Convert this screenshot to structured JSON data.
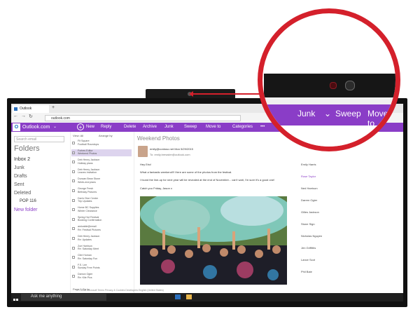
{
  "browser": {
    "tab_title": "Outlook",
    "address": "outlook.com"
  },
  "outlook_bar": {
    "logo": "O",
    "brand": "Outlook.com",
    "new": "New",
    "reply": "Reply",
    "delete": "Delete",
    "archive": "Archive",
    "junk": "Junk",
    "sweep": "Sweep",
    "move_to": "Move to",
    "categories": "Categories",
    "more": "•••"
  },
  "folders": {
    "search_placeholder": "Search email",
    "title": "Folders",
    "items": [
      {
        "label": "Inbox  2"
      },
      {
        "label": "Junk"
      },
      {
        "label": "Drafts"
      },
      {
        "label": "Sent"
      },
      {
        "label": "Deleted"
      },
      {
        "label": "POP  116"
      },
      {
        "label": "New folder"
      }
    ]
  },
  "list": {
    "header": "View: All",
    "arrange": "Arrange by",
    "messages": [
      "Fit Square\nFootball Roundups",
      "Forbes Editor\nWeekend Photos",
      "Deb Henry Jackson\nHoliday plans",
      "Deb Henry Jackson\nLeaves Invitation",
      "Duncan Bean Stone\nWeek-end plans",
      "George Fresh\nBirthday Pictures",
      "Dan's Dive Center\nTrip Updates",
      "Home BC Supplies\nWinter Clearance",
      "Spring Hot Festival\nBooking Confirmation",
      "amicable@email\nRe: Festival Pictures",
      "Deb Henry Jackson\nRe: Updates",
      "Zoe Harrison\nRe: Saturday Meet",
      "Clint Human\nRe: Saturday Fun",
      "F.S. Lee\nSunday Free Points",
      "Damon Ogier\nRe: Kite Pics"
    ],
    "pager": "Page 1  Go to"
  },
  "reading": {
    "subject": "Weekend Photos",
    "sender": "emily@contoso.net  Mon 5/29/2015",
    "to": "To: emily.brewster@outlook.com",
    "greeting": "Hey Eric!",
    "line1": "What a fantastic weekend!!! Here are some of the photos from the festival.",
    "line2": "I found the line-up for next year will be revealed at the end of November... can't wait, I'm sure it's a good one!",
    "line3": "Catch you Friday, Jason x"
  },
  "people": [
    "Emily Harris",
    "Rose Taylor",
    "Ned Harrison",
    "Darren Ogier",
    "Gilles Jackson",
    "Stone Sign",
    "Nicholas Nguyen",
    "Jen Griffiths",
    "Lance Scot",
    "Phil Baie"
  ],
  "footer": {
    "copyright": "© 2016 Microsoft   Terms   Privacy & Cookies   Developers   English (United States)"
  },
  "taskbar": {
    "search": "Ask me anything"
  },
  "zoom": {
    "junk": "Junk",
    "sweep": "Sweep",
    "move_to": "Move to"
  },
  "colors": {
    "outlook_purple": "#8a3dc7",
    "callout_red": "#d4202b"
  }
}
